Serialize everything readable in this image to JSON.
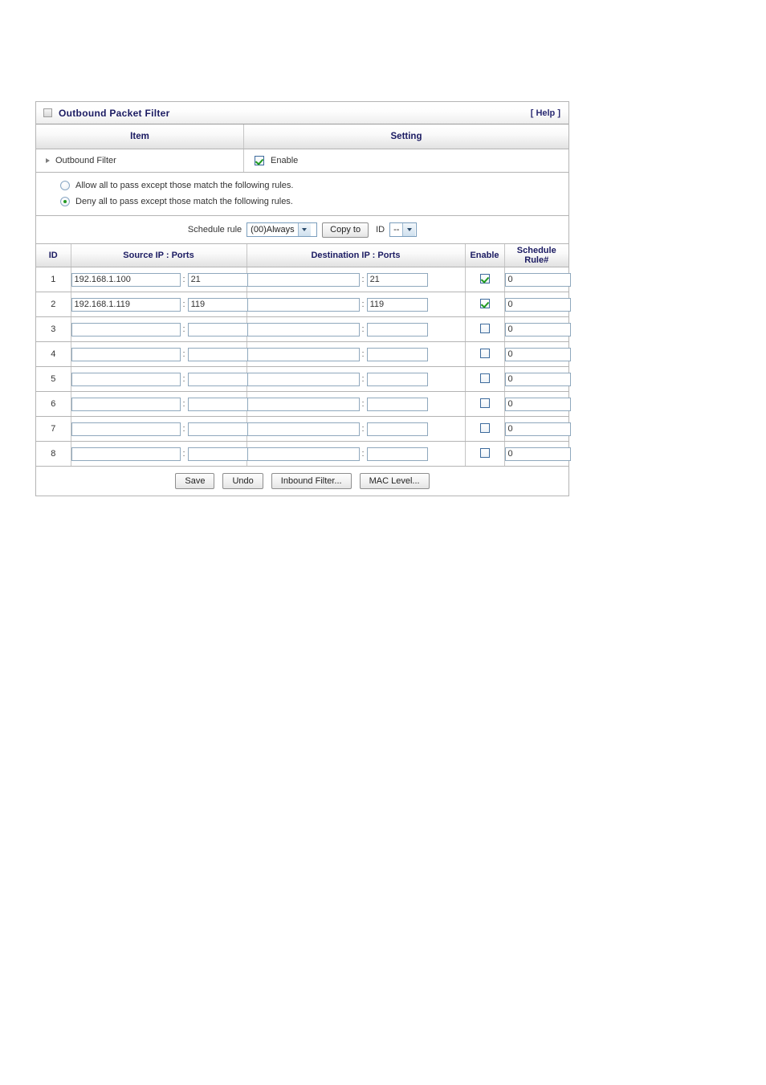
{
  "panel": {
    "icon": "panel-square-icon",
    "title": "Outbound Packet Filter",
    "help_label": "[ Help ]"
  },
  "columns": {
    "item": "Item",
    "setting": "Setting"
  },
  "outbound_filter": {
    "label": "Outbound Filter",
    "enable_label": "Enable",
    "enabled": true
  },
  "policy": {
    "allow_label": "Allow all to pass except those match the following rules.",
    "deny_label": "Deny all to pass except those match the following rules.",
    "selected": "deny"
  },
  "schedule": {
    "label": "Schedule rule",
    "rule_value": "(00)Always",
    "copy_to_label": "Copy to",
    "id_label": "ID",
    "id_value": "--"
  },
  "table": {
    "headers": [
      "ID",
      "Source IP : Ports",
      "Destination IP : Ports",
      "Enable",
      "Schedule Rule#"
    ],
    "rows": [
      {
        "id": "1",
        "src_ip": "192.168.1.100",
        "src_port": "21",
        "dst_ip": "",
        "dst_port": "21",
        "enabled": true,
        "schedule_rule": "0"
      },
      {
        "id": "2",
        "src_ip": "192.168.1.119",
        "src_port": "119",
        "dst_ip": "",
        "dst_port": "119",
        "enabled": true,
        "schedule_rule": "0"
      },
      {
        "id": "3",
        "src_ip": "",
        "src_port": "",
        "dst_ip": "",
        "dst_port": "",
        "enabled": false,
        "schedule_rule": "0"
      },
      {
        "id": "4",
        "src_ip": "",
        "src_port": "",
        "dst_ip": "",
        "dst_port": "",
        "enabled": false,
        "schedule_rule": "0"
      },
      {
        "id": "5",
        "src_ip": "",
        "src_port": "",
        "dst_ip": "",
        "dst_port": "",
        "enabled": false,
        "schedule_rule": "0"
      },
      {
        "id": "6",
        "src_ip": "",
        "src_port": "",
        "dst_ip": "",
        "dst_port": "",
        "enabled": false,
        "schedule_rule": "0"
      },
      {
        "id": "7",
        "src_ip": "",
        "src_port": "",
        "dst_ip": "",
        "dst_port": "",
        "enabled": false,
        "schedule_rule": "0"
      },
      {
        "id": "8",
        "src_ip": "",
        "src_port": "",
        "dst_ip": "",
        "dst_port": "",
        "enabled": false,
        "schedule_rule": "0"
      }
    ],
    "colon": ":"
  },
  "buttons": {
    "save": "Save",
    "undo": "Undo",
    "inbound_filter": "Inbound Filter...",
    "mac_level": "MAC Level..."
  },
  "colors": {
    "heading_blue": "#1b1b62",
    "check_green": "#1f9a1f",
    "panel_border": "#b4b4b4",
    "field_border": "#8fa8bd"
  }
}
